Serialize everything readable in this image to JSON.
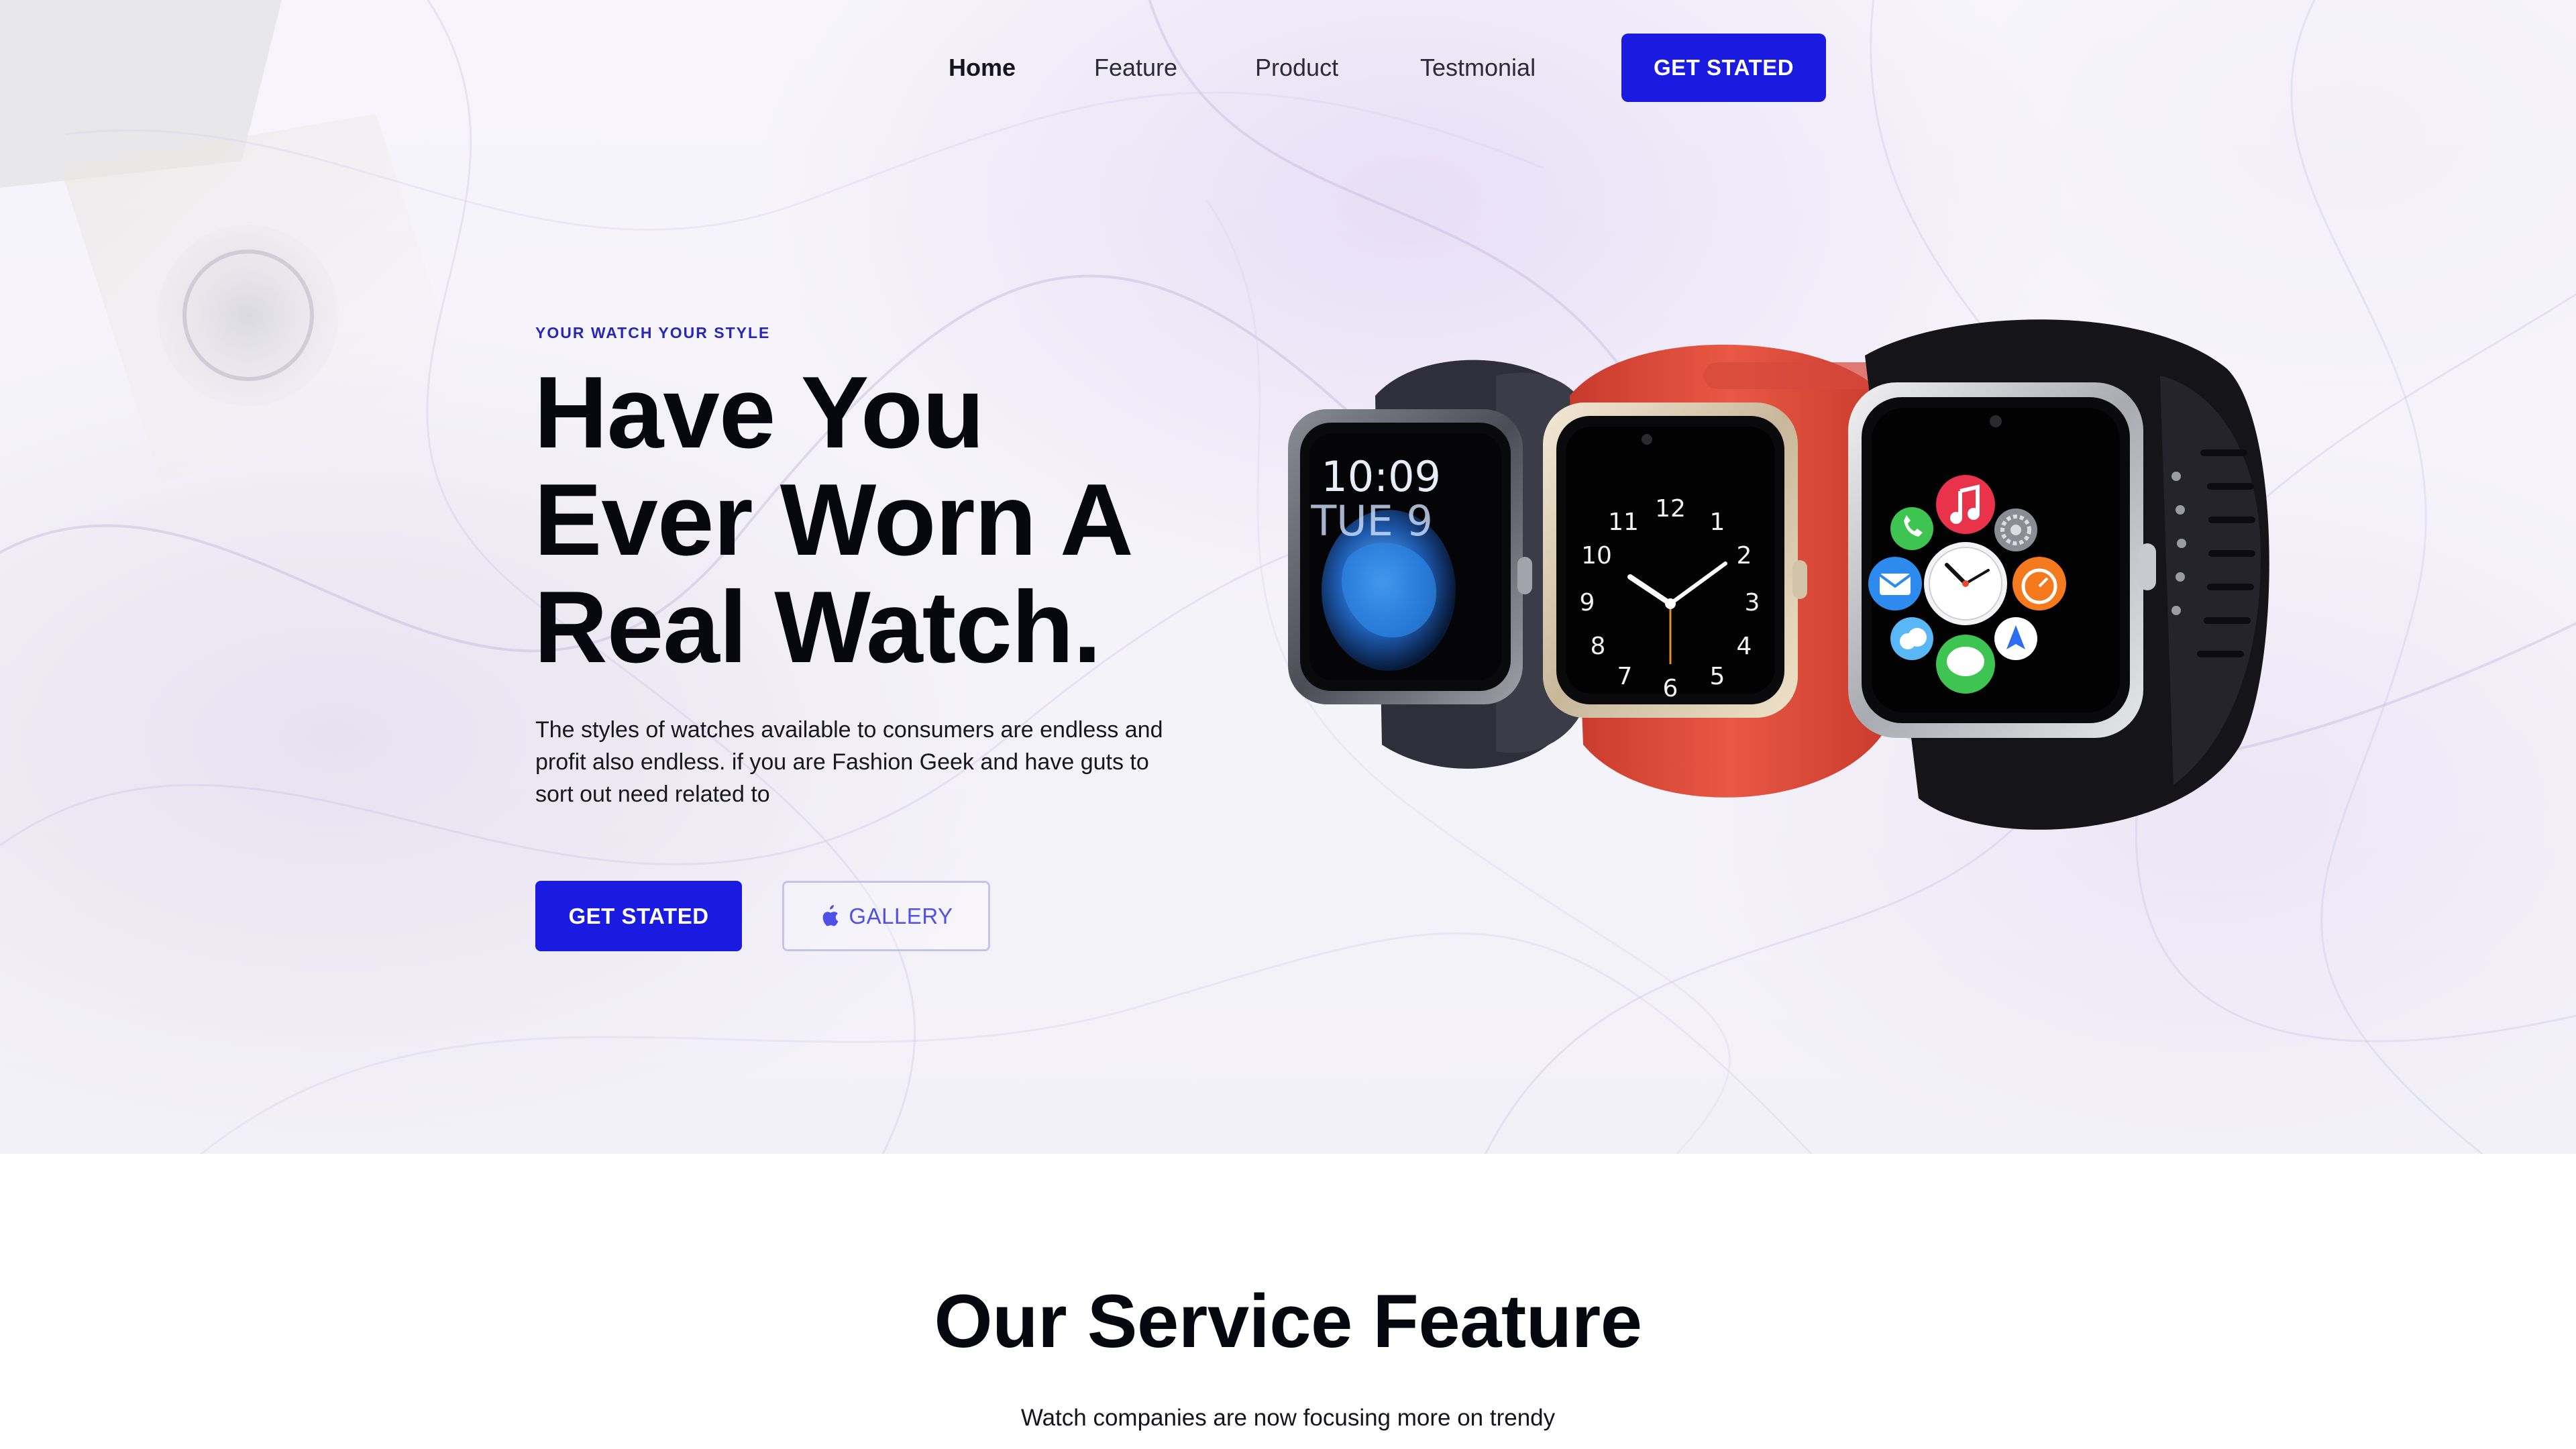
{
  "nav": {
    "links": [
      {
        "label": "Home",
        "active": true
      },
      {
        "label": "Feature",
        "active": false
      },
      {
        "label": "Product",
        "active": false
      },
      {
        "label": "Testmonial",
        "active": false
      }
    ],
    "cta_label": "GET STATED"
  },
  "hero": {
    "eyebrow": "YOUR WATCH YOUR STYLE",
    "headline_lines": [
      "Have You",
      "Ever Worn A",
      "Real Watch."
    ],
    "lead": "The styles of watches available to consumers are endless and profit also endless. if you are Fashion Geek and have guts to sort out need related to",
    "primary_button": "GET STATED",
    "secondary_button": "GALLERY",
    "watch_left_screen": {
      "time": "10:09",
      "date": "TUE 9"
    },
    "watch_middle_dial": [
      "12",
      "1",
      "2",
      "3",
      "4",
      "5",
      "6",
      "7",
      "8",
      "9",
      "10",
      "11"
    ]
  },
  "services": {
    "title": "Our Service Feature",
    "subtitle": "Watch companies are now focusing more on trendy"
  },
  "colors": {
    "accent": "#1a1ae0",
    "secondary_text": "#5050e6",
    "eyebrow": "#2727b8",
    "heading": "#07070f",
    "red_band": "#e04a3a"
  },
  "icons": [
    "apple-icon",
    "phone-icon",
    "music-icon",
    "settings-icon",
    "mail-icon",
    "clock-icon",
    "timer-icon",
    "weather-icon",
    "messages-icon",
    "maps-icon"
  ]
}
